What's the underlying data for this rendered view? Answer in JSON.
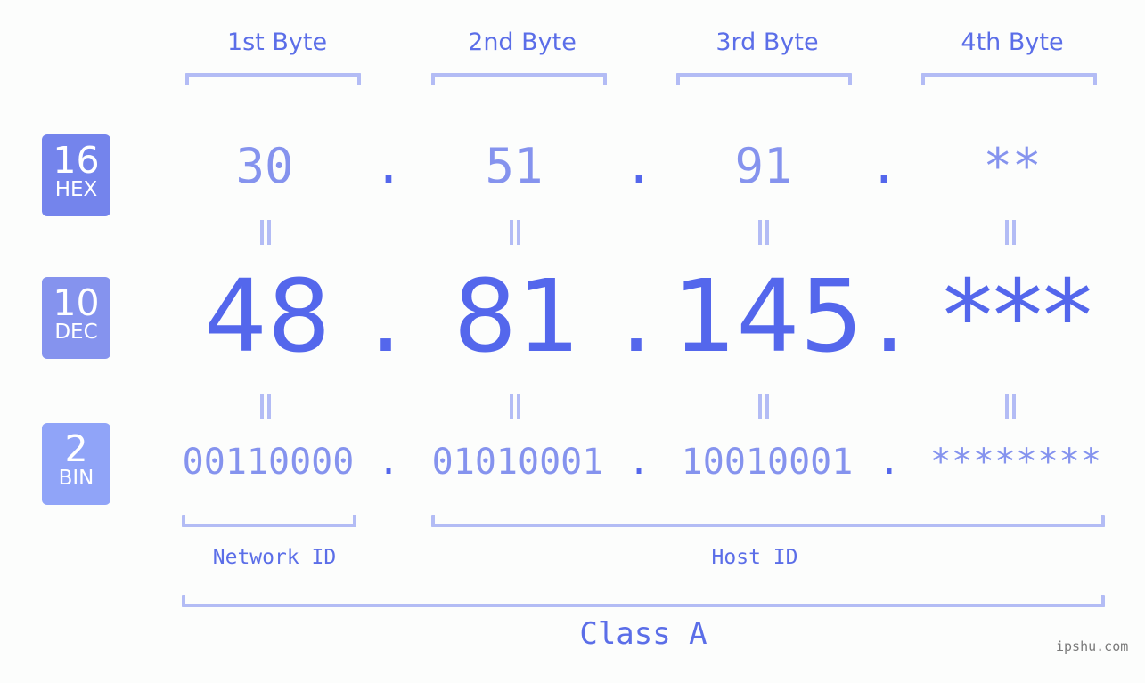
{
  "bytes": {
    "headers": [
      "1st Byte",
      "2nd Byte",
      "3rd Byte",
      "4th Byte"
    ],
    "hex": [
      "30",
      "51",
      "91",
      "**"
    ],
    "dec": [
      "48",
      "81",
      "145",
      "***"
    ],
    "bin": [
      "00110000",
      "01010001",
      "10010001",
      "********"
    ],
    "separator": "."
  },
  "badges": {
    "hex": {
      "num": "16",
      "label": "HEX",
      "color": "#7484ec"
    },
    "dec": {
      "num": "10",
      "label": "DEC",
      "color": "#8593ee"
    },
    "bin": {
      "num": "2",
      "label": "BIN",
      "color": "#90a4f8"
    }
  },
  "segments": {
    "network": "Network ID",
    "host": "Host ID",
    "class": "Class A"
  },
  "colors": {
    "accent": "#5467ec",
    "light": "#8593ee",
    "bracket": "#b3bcf5"
  },
  "watermark": "ipshu.com"
}
